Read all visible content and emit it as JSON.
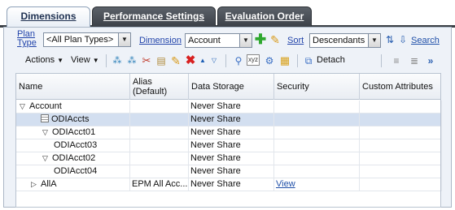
{
  "tabs": [
    {
      "label": "Dimensions",
      "active": true
    },
    {
      "label": "Performance Settings",
      "active": false
    },
    {
      "label": "Evaluation Order",
      "active": false
    }
  ],
  "toolbar": {
    "plan_type_label": "Plan Type",
    "plan_type_value": "<All Plan Types>",
    "dimension_label": "Dimension",
    "dimension_value": "Account",
    "sort_label": "Sort",
    "sort_value": "Descendants",
    "search_label": "Search",
    "actions_label": "Actions",
    "view_label": "View",
    "detach_label": "Detach"
  },
  "table": {
    "columns": [
      "Name",
      "Alias (Default)",
      "Data Storage",
      "Security",
      "Custom Attributes"
    ],
    "rows": [
      {
        "name": "Account",
        "indent": 0,
        "expander": "▽",
        "alias": "",
        "storage": "Never Share",
        "security": "",
        "selected": false
      },
      {
        "name": "ODIAccts",
        "indent": 1,
        "expander": "",
        "icon": true,
        "alias": "",
        "storage": "Never Share",
        "security": "",
        "selected": true
      },
      {
        "name": "ODIAcct01",
        "indent": 2,
        "expander": "▽",
        "alias": "",
        "storage": "Never Share",
        "security": "",
        "selected": false
      },
      {
        "name": "ODIAcct03",
        "indent": 3,
        "expander": "",
        "alias": "",
        "storage": "Never Share",
        "security": "",
        "selected": false
      },
      {
        "name": "ODIAcct02",
        "indent": 2,
        "expander": "▽",
        "alias": "",
        "storage": "Never Share",
        "security": "",
        "selected": false
      },
      {
        "name": "ODIAcct04",
        "indent": 3,
        "expander": "",
        "alias": "",
        "storage": "Never Share",
        "security": "",
        "selected": false
      },
      {
        "name": "AllA",
        "indent": 1,
        "expander": "▷",
        "alias": "EPM All Acc...",
        "storage": "Never Share",
        "security": "View",
        "selected": false
      }
    ]
  },
  "colors": {
    "tab_bar": "#3a3f45",
    "panel_bg": "#eef2f8",
    "selected_row": "#d3dff0",
    "link": "#1f4fa8",
    "add_icon": "#2fa82f",
    "delete_icon": "#d82020"
  }
}
